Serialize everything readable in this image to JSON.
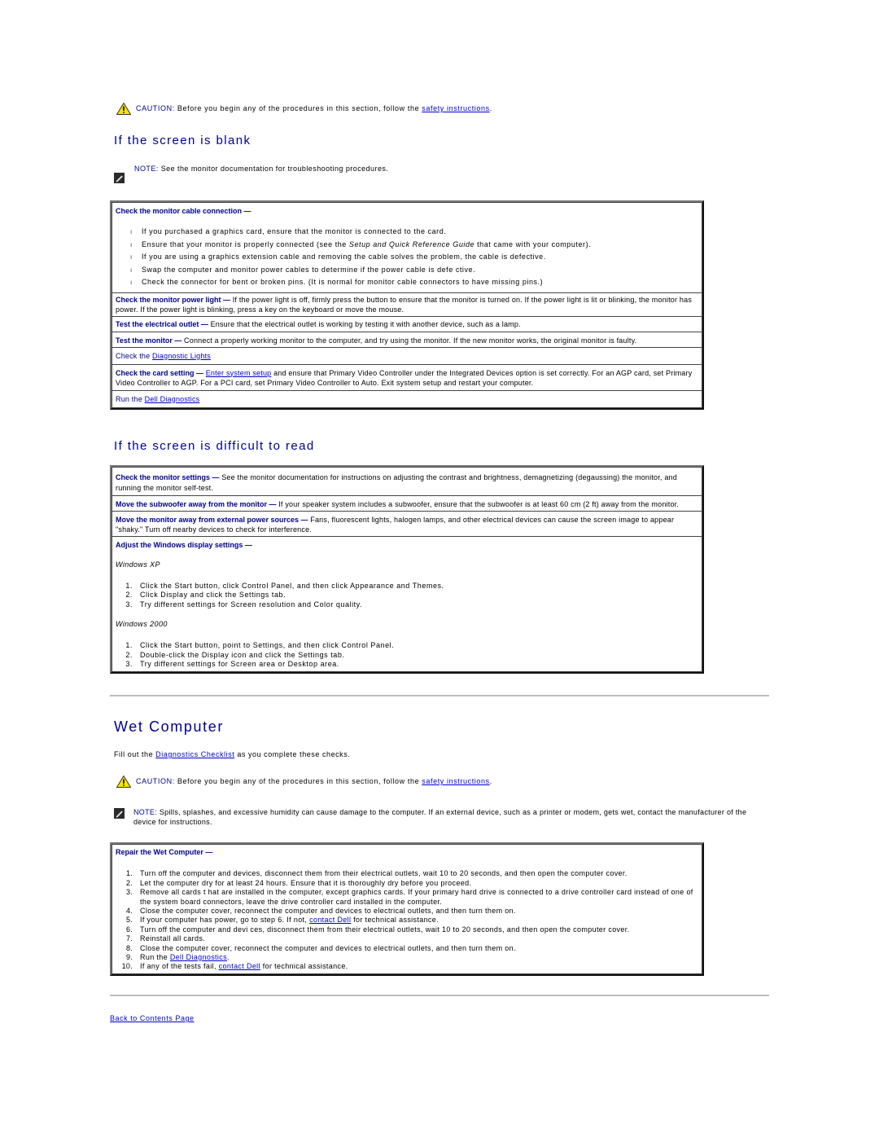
{
  "caution_1": {
    "label": "CAUTION:",
    "text": " Before you begin any of the procedures in this section, follow the ",
    "link": "safety instructions",
    "end": "."
  },
  "section_blank": {
    "title": "If the screen is blank",
    "note_label": "NOTE:",
    "note_text": " See the monitor documentation for troubleshooting procedures.",
    "cable": {
      "heading": "Check the monitor cable connection  —",
      "items": [
        "If you purchased a graphics card, ensure that the monitor is connected to the card.",
        "Ensure that your monitor is properly connected (see the ",
        "If you are using a graphics extension cable and removing the cable solves the problem, the cable is defective.",
        "Swap the computer and monitor power cables to determine if the power cable is defe ctive.",
        "Check the connector for bent or broken pins. (It is normal for monitor cable connectors to have missing pins.)"
      ],
      "item2_italic": "Setup and Quick Reference Guide",
      "item2_end": " that came with your computer)."
    },
    "power_light": {
      "heading": "Check the monitor power light  —",
      "text": " If the power light is off, firmly press the button to ensure that the monitor is turned on. If the power light is lit or blinking, the monitor has power. If the power light is blinking, press a key on the keyboard or move the mouse."
    },
    "outlet": {
      "heading": "Test the electrical outlet  —",
      "text": " Ensure that the electrical outlet is working by testing it with another device, such as a lamp."
    },
    "test_monitor": {
      "heading": "Test the monitor  —",
      "text": " Connect a properly working monitor to the computer, and try using the monitor. If the new monitor works, the original monitor is faulty."
    },
    "diag_lights": {
      "prefix": "Check the ",
      "link": "Diagnostic Lights"
    },
    "card_setting": {
      "heading": "Check the card setting  —",
      "link": "Enter system setup",
      "text": " and ensure that Primary Video Controller under the Integrated Devices option is set correctly. For an AGP card, set Primary Video Controller to AGP. For a PCI card, set Primary Video Controller to Auto. Exit system setup and restart your computer."
    },
    "run_diag": {
      "prefix": "Run the ",
      "link": "Dell Diagnostics"
    }
  },
  "section_difficult": {
    "title": "If the screen is difficult to read",
    "monitor_settings": {
      "heading": "Check the monitor settings  —",
      "text": "  See the monitor documentation for instructions on adjusting the contrast and brightness, demagnetizing (degaussing) the monitor, and running the monitor self-test."
    },
    "subwoofer": {
      "heading": "Move the subwoofer away from the monitor  —",
      "text": " If your speaker system includes a subwoofer, ensure that the subwoofer is at least 60 cm (2 ft) away from the monitor."
    },
    "power_sources": {
      "heading": "Move the monitor away from external power sources  —",
      "text": " Fans, fluorescent lights, halogen lamps, and other electrical devices can cause the screen image to appear \"shaky.\" Turn off nearby devices to check for interference."
    },
    "windows_display": {
      "heading": "Adjust the Windows display settings  —",
      "xp_label": "Windows XP",
      "xp_steps": [
        "Click the  Start button, click Control Panel, and then click Appearance and Themes.",
        "Click  Display and click the Settings tab.",
        "Try different settings for  Screen resolution and Color quality."
      ],
      "w2k_label": "Windows 2000",
      "w2k_steps": [
        "Click the  Start button, point to Settings, and then click Control Panel.",
        "Double-click the  Display icon and click the Settings tab.",
        "Try different settings for  Screen area or Desktop area."
      ]
    }
  },
  "section_wet": {
    "title": "Wet Computer",
    "intro_prefix": "Fill out the ",
    "intro_link": "Diagnostics Checklist",
    "intro_suffix": " as you complete these checks.",
    "caution_label": "CAUTION:",
    "caution_text": " Before you begin any of the procedures in this section, follow the ",
    "caution_link": "safety instructions",
    "caution_end": ".",
    "note_label": "NOTE:",
    "note_text": " Spills, splashes, and excessive humidity can cause damage to the computer. If an external device, such as a printer or modem, gets wet, contact the manufacturer of the device for instructions.",
    "repair": {
      "heading": "Repair the Wet Computer  —",
      "steps": [
        "Turn off the computer and devices, disconnect them from their electrical outlets, wait 10 to 20 seconds, and then open the computer cover.",
        "Let the computer dry for at least 24 hours. Ensure that it is thoroughly dry before you proceed.",
        "Remove all cards t hat are installed in the computer, except graphics cards. If your primary hard drive is connected to a drive controller card instead of one of the system board connectors, leave the drive controller card installed in the computer.",
        "Close the computer cover, reconnect the computer and devices to electrical outlets, and then turn them on.",
        "If your computer has power, go to step 6. If not,  ",
        "Turn off the computer and devi ces, disconnect them from their electrical outlets, wait 10 to 20 seconds, and then open the computer cover.",
        "Reinstall all cards.",
        "Close the computer cover, reconnect the computer and devices to electrical outlets, and then turn them on.",
        "Run the  ",
        "If any of the tests fail,  "
      ],
      "step5_link": "contact Dell",
      "step5_end": " for technical assistance.",
      "step9_link": "Dell Diagnostics",
      "step9_end": ".",
      "step10_link": "contact Dell",
      "step10_end": " for technical assistance."
    }
  },
  "footer": {
    "back_link": "Back to Contents Page"
  }
}
